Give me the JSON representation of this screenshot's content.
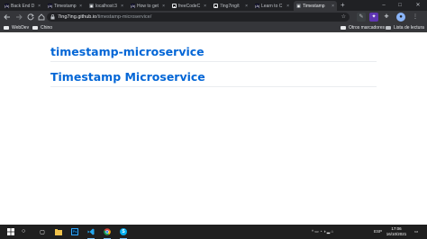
{
  "browser": {
    "tabs": [
      {
        "title": "Back End D",
        "favicon": "freecodecamp-icon",
        "fav_color": "#0a0a23",
        "fav_glyph": "(A)"
      },
      {
        "title": "Timestamp",
        "favicon": "freecodecamp-icon",
        "fav_color": "#0a0a23",
        "fav_glyph": "(A)"
      },
      {
        "title": "localhost:3",
        "favicon": "globe-icon",
        "fav_color": "#5f6368",
        "fav_glyph": "◉"
      },
      {
        "title": "How to get",
        "favicon": "freecodecamp-icon",
        "fav_color": "#0a0a23",
        "fav_glyph": "(A)"
      },
      {
        "title": "freeCodeC",
        "favicon": "github-icon",
        "fav_color": "#202124",
        "fav_glyph": "●"
      },
      {
        "title": "7ing7ing/t",
        "favicon": "github-icon",
        "fav_color": "#202124",
        "fav_glyph": "●"
      },
      {
        "title": "Learn to C",
        "favicon": "freecodecamp-icon",
        "fav_color": "#0a0a23",
        "fav_glyph": "(A)"
      },
      {
        "title": "Timestamp",
        "favicon": "globe-icon",
        "fav_color": "#5f6368",
        "fav_glyph": "◉"
      }
    ],
    "active_tab": 7,
    "close_glyph": "×",
    "new_tab_glyph": "+",
    "window_controls": [
      "–",
      "□",
      "✕"
    ],
    "url_host": "7ing7ing.github.io",
    "url_path": "/timestamp-microservice/",
    "bookmarks": [
      {
        "label": "WebDev"
      },
      {
        "label": "Chino"
      }
    ],
    "bookmarks_right": [
      {
        "label": "Otros marcadores"
      },
      {
        "label": "Lista de lectura"
      }
    ]
  },
  "page": {
    "heading_1": "timestamp-microservice",
    "heading_2": "Timestamp Microservice",
    "link_color": "#0366d6"
  },
  "taskbar": {
    "apps": [
      {
        "name": "task-view-icon",
        "glyph": "▢"
      },
      {
        "name": "file-explorer-icon",
        "glyph": "▬"
      },
      {
        "name": "photoshop-icon",
        "glyph": "Ps"
      },
      {
        "name": "vscode-icon",
        "glyph": "⟩"
      },
      {
        "name": "chrome-icon",
        "glyph": "◉"
      },
      {
        "name": "skype-icon",
        "glyph": "S"
      }
    ],
    "tray_lang": "ESP",
    "clock_time": "17:06",
    "clock_date": "16/10/2021"
  }
}
